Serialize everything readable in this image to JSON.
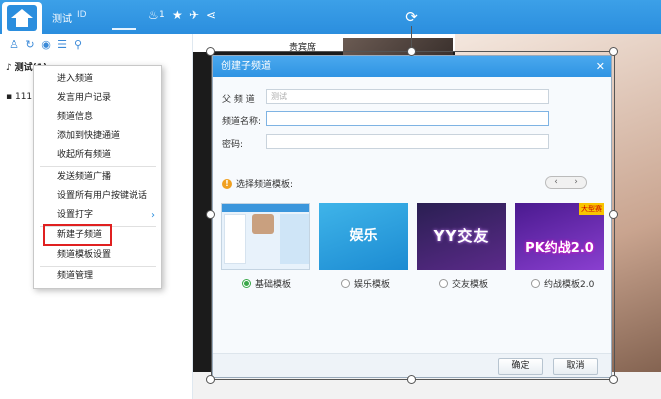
{
  "topbar": {
    "title": "测试",
    "id_label": "ID",
    "fans_count": "1"
  },
  "left_panel": {
    "channel_name": "测试(1)",
    "sub_row": "111"
  },
  "video": {
    "guest_label": "贵宾席"
  },
  "context_menu": {
    "items": [
      "进入频道",
      "发言用户记录",
      "频道信息",
      "添加到快捷通道",
      "收起所有频道",
      "发送频道广播",
      "设置所有用户按键说话",
      "设置打字",
      "新建子频道",
      "频道模板设置",
      "频道管理"
    ]
  },
  "dialog": {
    "title": "创建子频道",
    "parent_label": "父 频 道",
    "parent_value": "测试",
    "name_label": "频道名称:",
    "password_label": "密码:",
    "template_heading": "选择频道模板:",
    "templates": [
      {
        "label": "基础模板",
        "thumb": ""
      },
      {
        "label": "娱乐模板",
        "thumb": "娱乐"
      },
      {
        "label": "交友模板",
        "thumb": "YY交友"
      },
      {
        "label": "约战模板2.0",
        "thumb": "PK约战2.0",
        "badge": "大型赛"
      }
    ],
    "ok_label": "确定",
    "cancel_label": "取消"
  }
}
